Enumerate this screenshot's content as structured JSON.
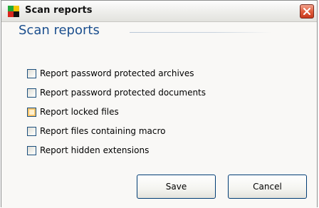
{
  "window": {
    "title": "Scan reports",
    "app_icon": "avg-logo-icon",
    "close_icon": "close-icon"
  },
  "section": {
    "heading": "Scan reports"
  },
  "options": [
    {
      "label": "Report password protected archives",
      "checked": false
    },
    {
      "label": "Report password protected documents",
      "checked": false
    },
    {
      "label": "Report locked files",
      "checked": false,
      "hovered": true
    },
    {
      "label": "Report files containing macro",
      "checked": false
    },
    {
      "label": "Report hidden extensions",
      "checked": false
    }
  ],
  "buttons": {
    "save": "Save",
    "cancel": "Cancel"
  },
  "colors": {
    "heading": "#1c4f8e",
    "close_button": "#e15e3e",
    "button_border": "#003c74"
  }
}
